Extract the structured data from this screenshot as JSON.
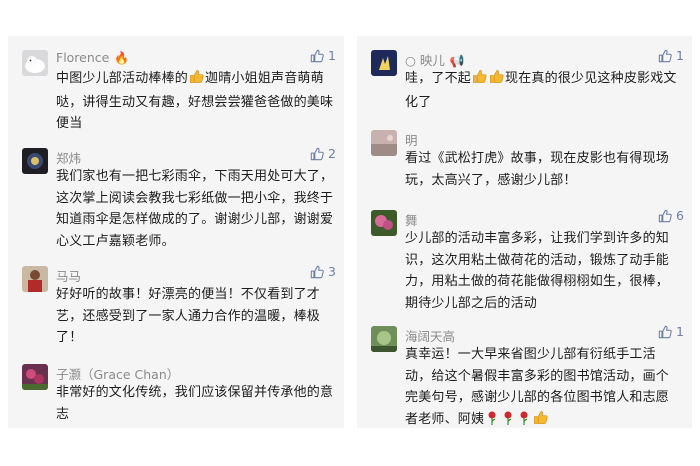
{
  "colors": {
    "panel_bg": "#f5f5f5",
    "name": "#8a8a8a",
    "like": "#6b7ea8",
    "text": "#1c1c1c"
  },
  "left_comments": [
    {
      "name": "Florence",
      "name_emoji": "fire-icon",
      "likes": "1",
      "text_parts": [
        "中图少儿部活动棒棒的",
        "迦晴小姐姐声音萌萌哒，讲得生动又有趣，好想尝尝獾爸爸做的美味便当"
      ]
    },
    {
      "name": "郑炜",
      "likes": "2",
      "text": "我们家也有一把七彩雨伞，下雨天用处可大了，这次掌上阅读会教我七彩纸做一把小伞，我终于知道雨伞是怎样做成的了。谢谢少儿部，谢谢爱心义工卢嘉颖老师。"
    },
    {
      "name": "马马",
      "likes": "3",
      "text": "好好听的故事！好漂亮的便当！不仅看到了才艺，还感受到了一家人通力合作的温暖，棒极了！"
    },
    {
      "name": "子灏（Grace Chan）",
      "likes": "",
      "text": "非常好的文化传统，我们应该保留并传承他的意志"
    }
  ],
  "right_comments": [
    {
      "name": "映儿",
      "name_prefix": "○",
      "name_emoji": "megaphone-icon",
      "likes": "1",
      "text_parts": [
        "哇，了不起",
        "现在真的很少见这种皮影戏文化了"
      ]
    },
    {
      "name": "明",
      "likes": "",
      "text": "看过《武松打虎》故事，现在皮影也有得现场玩，太高兴了，感谢少儿部！"
    },
    {
      "name": "舞",
      "likes": "6",
      "text": "少儿部的活动丰富多彩，让我们学到许多的知识，这次用粘土做荷花的活动，锻炼了动手能力，用粘土做的荷花能做得栩栩如生，很棒，期待少儿部之后的活动"
    },
    {
      "name": "海阔天高",
      "likes": "1",
      "text": "真幸运！一大早来省图少儿部有衍纸手工活动，给这个暑假丰富多彩的图书馆活动，画个完美句号，感谢少儿部的各位图书馆人和志愿者老师、阿姨"
    }
  ]
}
